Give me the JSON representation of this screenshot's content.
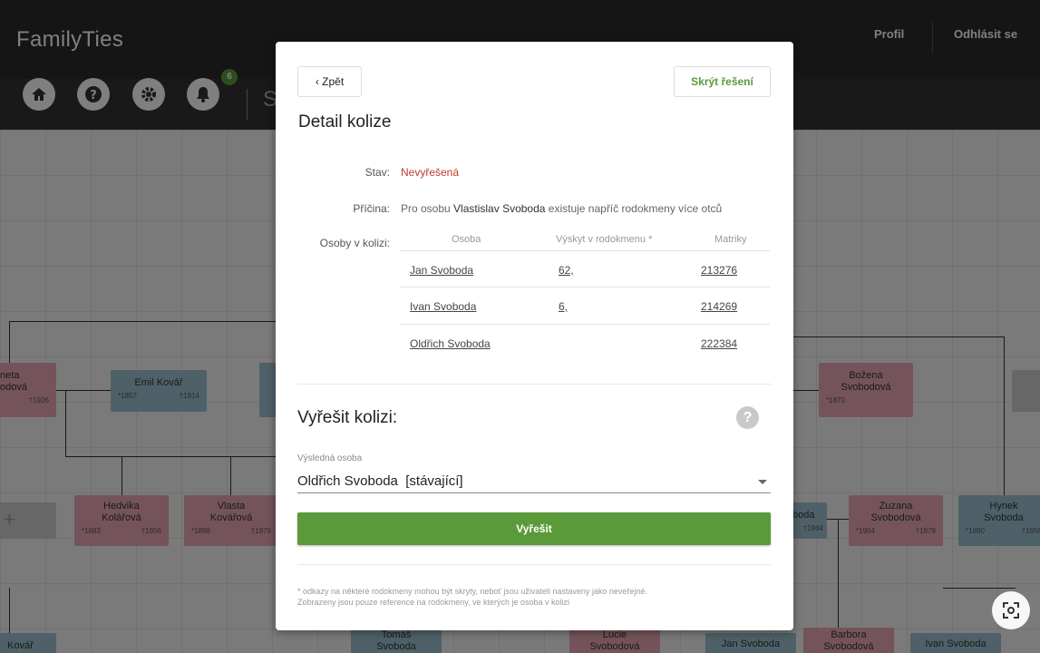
{
  "app": {
    "logo": "FamilyTies",
    "nav": {
      "profile": "Profil",
      "logout": "Odhlásit se"
    },
    "notification_count": "6",
    "toolbar_text": "S"
  },
  "tree": {
    "cards": [
      {
        "name": "neta\nodová",
        "birth": "",
        "death": "†1926"
      },
      {
        "name": "Emil Kovář",
        "birth": "*1857",
        "death": "†1914"
      },
      {
        "name": "Božena\nSvobodová",
        "birth": "*1870",
        "death": ""
      },
      {
        "name": "Hedvika\nKolářová",
        "birth": "*1883",
        "death": "†1956"
      },
      {
        "name": "Vlasta\nKovářová",
        "birth": "*1898",
        "death": "†1979"
      },
      {
        "name": "boda",
        "birth": "",
        "death": "†1964"
      },
      {
        "name": "Zuzana\nSvobodová",
        "birth": "*1904",
        "death": "†1979"
      },
      {
        "name": "Hynek\nSvoboda",
        "birth": "*1890",
        "death": "†1958"
      },
      {
        "name": "Kovář",
        "birth": "",
        "death": ""
      },
      {
        "name": "Tomáš\nSvoboda",
        "birth": "",
        "death": ""
      },
      {
        "name": "Lucie\nSvobodová",
        "birth": "",
        "death": ""
      },
      {
        "name": "Jan Svoboda",
        "birth": "",
        "death": ""
      },
      {
        "name": "Barbora\nSvobodová",
        "birth": "",
        "death": ""
      },
      {
        "name": "Ivan Svoboda",
        "birth": "",
        "death": ""
      }
    ]
  },
  "modal": {
    "back_label": "‹ Zpět",
    "hide_label": "Skrýt řešení",
    "title": "Detail kolize",
    "status_label": "Stav:",
    "status_value": "Nevyřešená",
    "cause_label": "Příčina:",
    "cause_pre": "Pro osobu ",
    "cause_person": "Vlastislav Svoboda",
    "cause_post": " existuje napříč rodokmeny více otců",
    "persons_label": "Osoby v kolizi:",
    "table": {
      "headers": [
        "Osoba",
        "Výskyt v rodokmenu *",
        "Matriky"
      ],
      "rows": [
        {
          "person": "Jan Svoboda",
          "occurrence": "62,",
          "register": "213276"
        },
        {
          "person": "Ivan Svoboda",
          "occurrence": "6,",
          "register": "214269"
        },
        {
          "person": "Oldřich Svoboda",
          "occurrence": "",
          "register": "222384"
        }
      ]
    },
    "resolve_title": "Vyřešit kolizi:",
    "help_icon_text": "?",
    "result_label": "Výsledná osoba",
    "result_value": "Oldřich Svoboda  [stávající]",
    "resolve_button": "Vyřešit",
    "footnote_line1": "* odkazy na některé rodokmeny mohou být skryty, neboť jsou uživateli nastaveny jako neveřejné.",
    "footnote_line2": "Zobrazeny jsou pouze reference na rodokmeny, ve kterých je osoba v kolizi"
  },
  "colors": {
    "accent": "#5a9a3a",
    "status": "#c0392b",
    "female": "#e9a9b4",
    "male": "#9cc3d0"
  }
}
